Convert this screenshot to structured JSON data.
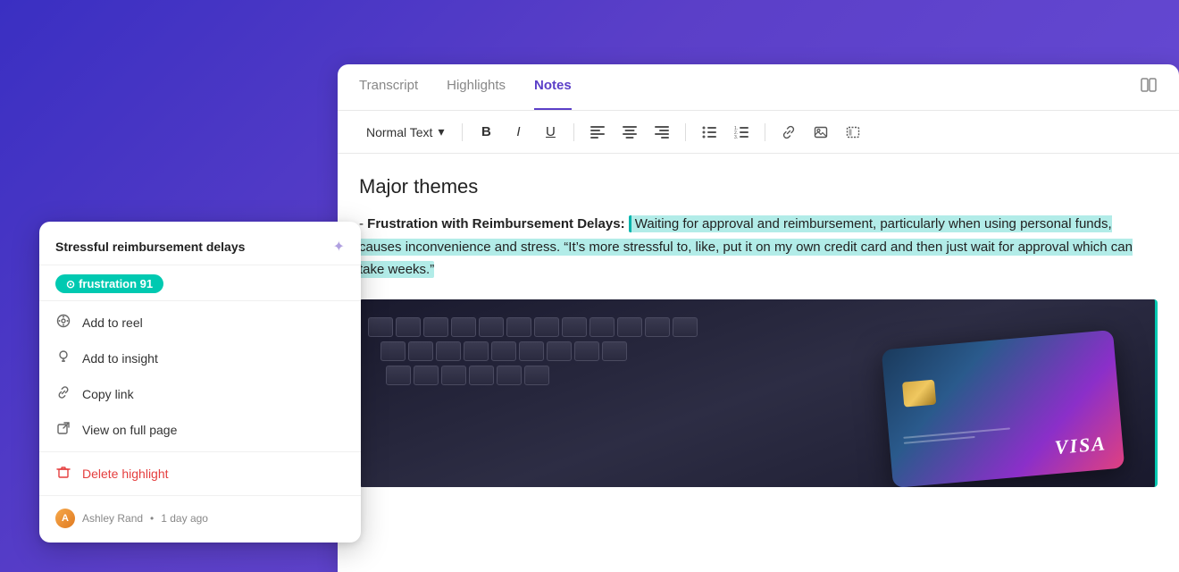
{
  "background": {
    "gradient": "linear-gradient(135deg, #3a2fc2, #6b4fd8)"
  },
  "tabs": {
    "items": [
      {
        "label": "Transcript",
        "active": false
      },
      {
        "label": "Highlights",
        "active": false
      },
      {
        "label": "Notes",
        "active": true
      }
    ]
  },
  "toolbar": {
    "text_style_label": "Normal Text",
    "buttons": [
      "B",
      "I",
      "U"
    ]
  },
  "content": {
    "heading": "Major themes",
    "paragraph_prefix": "- ",
    "bold_text": "Frustration with Reimbursement Delays:",
    "highlighted_text": "Waiting for approval and reimbursement, particularly when using personal funds, causes inconvenience and stress. “It’s more stressful to, like, put it on my own credit card and then just wait for approval which can take weeks.”"
  },
  "popup": {
    "title": "Stressful reimbursement delays",
    "tag": {
      "label": "frustration",
      "score": "91"
    },
    "menu_items": [
      {
        "label": "Add to reel",
        "icon": "reel"
      },
      {
        "label": "Add to insight",
        "icon": "insight"
      },
      {
        "label": "Copy link",
        "icon": "link"
      },
      {
        "label": "View on full page",
        "icon": "external"
      },
      {
        "label": "Delete highlight",
        "icon": "trash",
        "danger": true
      }
    ],
    "footer": {
      "user": "Ashley Rand",
      "time": "1 day ago"
    }
  }
}
